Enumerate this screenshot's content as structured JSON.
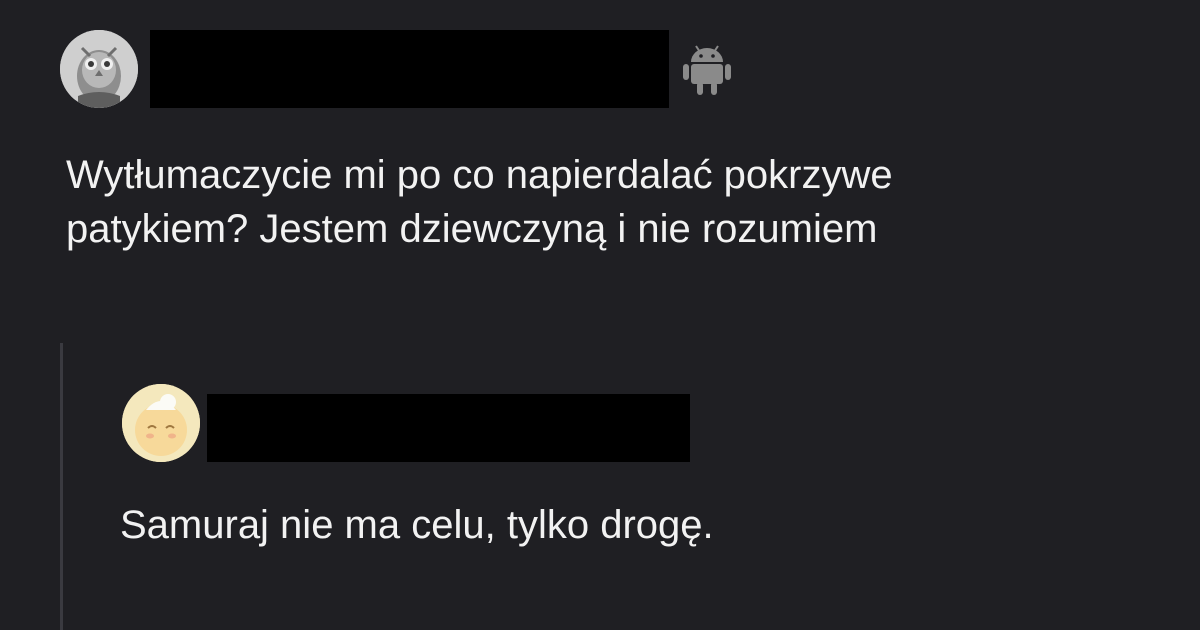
{
  "post": {
    "author_icon": "android-icon",
    "text_line1": "Wytłumaczycie mi po co napierdalać pokrzywe",
    "text_line2": "patykiem? Jestem dziewczyną i nie rozumiem"
  },
  "reply": {
    "text": "Samuraj nie ma celu, tylko drogę."
  },
  "colors": {
    "background": "#1f1f23",
    "text": "#f2f2f2",
    "redaction": "#000000",
    "thread_line": "#3a3a40",
    "android_icon": "#8a8a8a"
  }
}
